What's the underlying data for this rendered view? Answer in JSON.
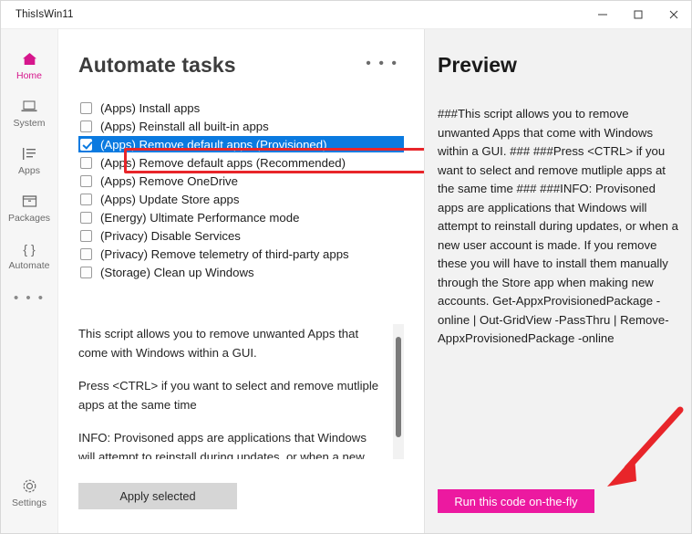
{
  "window": {
    "title": "ThisIsWin11",
    "controls": [
      {
        "name": "minimize",
        "glyph": "—"
      },
      {
        "name": "maximize",
        "glyph": "▢"
      },
      {
        "name": "close",
        "glyph": "✕"
      }
    ]
  },
  "sidebar": {
    "items": [
      {
        "label": "Home",
        "icon": "home-icon",
        "active": true
      },
      {
        "label": "System",
        "icon": "laptop-icon",
        "active": false
      },
      {
        "label": "Apps",
        "icon": "list-icon",
        "active": false
      },
      {
        "label": "Packages",
        "icon": "box-icon",
        "active": false
      },
      {
        "label": "Automate",
        "icon": "braces-icon",
        "active": false
      }
    ],
    "more_label": "• • •",
    "settings": {
      "label": "Settings",
      "icon": "gear-icon"
    }
  },
  "main": {
    "page_title": "Automate tasks",
    "overflow_label": "• • •",
    "tasks": [
      {
        "label": "(Apps) Install apps",
        "checked": false,
        "selected": false
      },
      {
        "label": "(Apps) Reinstall all built-in apps",
        "checked": false,
        "selected": false
      },
      {
        "label": "(Apps) Remove default apps (Provisioned)",
        "checked": true,
        "selected": true
      },
      {
        "label": "(Apps) Remove default apps (Recommended)",
        "checked": false,
        "selected": false
      },
      {
        "label": "(Apps) Remove OneDrive",
        "checked": false,
        "selected": false
      },
      {
        "label": "(Apps) Update Store apps",
        "checked": false,
        "selected": false
      },
      {
        "label": "(Energy) Ultimate Performance mode",
        "checked": false,
        "selected": false
      },
      {
        "label": "(Privacy) Disable Services",
        "checked": false,
        "selected": false
      },
      {
        "label": "(Privacy) Remove telemetry of third-party apps",
        "checked": false,
        "selected": false
      },
      {
        "label": "(Storage) Clean up Windows",
        "checked": false,
        "selected": false
      }
    ],
    "description_paragraphs": [
      "This script allows you to remove unwanted Apps that come with Windows within a GUI.",
      "Press <CTRL> if you want to select and remove mutliple apps at the same time",
      "INFO: Provisoned apps are applications that Windows will attempt to reinstall during updates, or when a new user account is made. If you remove these you will have to install them manually through the"
    ],
    "apply_button": "Apply selected"
  },
  "preview": {
    "title": "Preview",
    "script_text": "###This script allows you to remove unwanted Apps that come with Windows within a GUI. ### ###Press <CTRL> if you want to select and remove mutliple apps at the same time ### ###INFO: Provisoned apps are applications that Windows will attempt to reinstall during updates, or when a new user account is made. If you remove these you will have to install them manually through the Store app when making new accounts. Get-AppxProvisionedPackage -online | Out-GridView -PassThru | Remove-AppxProvisionedPackage -online",
    "run_button": "Run this code on-the-fly"
  },
  "annotations": {
    "highlight_box_color": "#e8252a",
    "arrow_color": "#e8252a",
    "arrow_target": "run-this-code-on-the-fly-button"
  },
  "colors": {
    "accent": "#d6168c",
    "run_button": "#ec19a0",
    "selection": "#0a7ae0",
    "sidebar_bg": "#f6f6f6",
    "preview_bg": "#f2f2f2"
  }
}
